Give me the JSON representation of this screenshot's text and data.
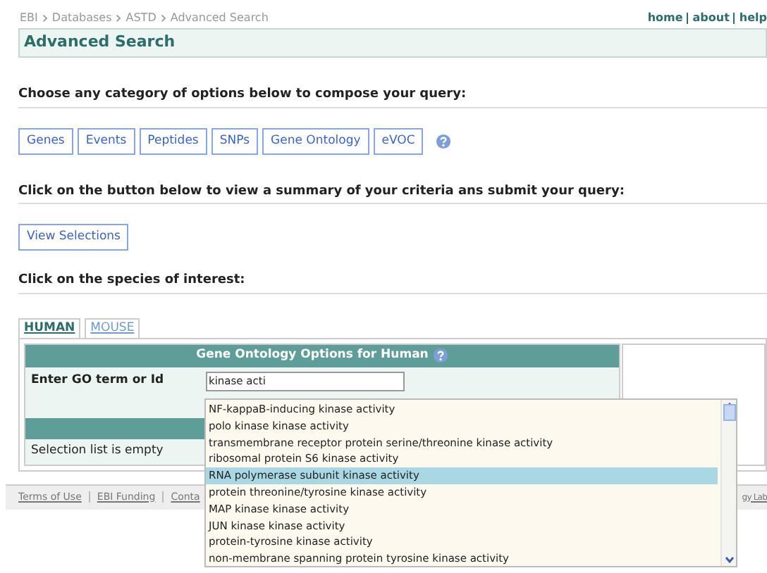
{
  "breadcrumb": [
    "EBI",
    "Databases",
    "ASTD",
    "Advanced Search"
  ],
  "top_links": [
    "home",
    "about",
    "help"
  ],
  "title": "Advanced Search",
  "section_1": "Choose any category of options below to compose your query:",
  "categories": [
    "Genes",
    "Events",
    "Peptides",
    "SNPs",
    "Gene Ontology",
    "eVOC"
  ],
  "section_2": "Click on the button below to view a summary of your criteria ans submit your query:",
  "view_button": "View Selections",
  "section_3": "Click on the species of interest:",
  "species_tabs": [
    {
      "label": "HUMAN",
      "selected": true
    },
    {
      "label": "MOUSE",
      "selected": false
    }
  ],
  "panel": {
    "header": "Gene Ontology Options for Human",
    "field_label": "Enter GO term or Id",
    "field_value": "kinase acti",
    "selection_text": "Selection list is empty"
  },
  "suggestions": [
    {
      "label": "NF-kappaB-inducing kinase activity",
      "selected": false
    },
    {
      "label": "polo kinase kinase activity",
      "selected": false
    },
    {
      "label": "transmembrane receptor protein serine/threonine kinase activity",
      "selected": false
    },
    {
      "label": "ribosomal protein S6 kinase activity",
      "selected": false
    },
    {
      "label": "RNA polymerase subunit kinase activity",
      "selected": true
    },
    {
      "label": "protein threonine/tyrosine kinase activity",
      "selected": false
    },
    {
      "label": "MAP kinase kinase activity",
      "selected": false
    },
    {
      "label": "JUN kinase kinase activity",
      "selected": false
    },
    {
      "label": "protein-tyrosine kinase activity",
      "selected": false
    },
    {
      "label": "non-membrane spanning protein tyrosine kinase activity",
      "selected": false
    }
  ],
  "footer_links": [
    "Terms of Use",
    "EBI Funding",
    "Conta",
    "gy Lab"
  ]
}
